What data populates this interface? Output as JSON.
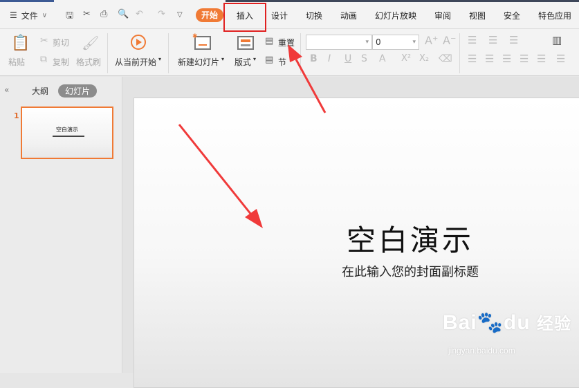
{
  "menu": {
    "file_label": "文件"
  },
  "tabs": [
    {
      "label": "开始"
    },
    {
      "label": "插入"
    },
    {
      "label": "设计"
    },
    {
      "label": "切换"
    },
    {
      "label": "动画"
    },
    {
      "label": "幻灯片放映"
    },
    {
      "label": "审阅"
    },
    {
      "label": "视图"
    },
    {
      "label": "安全"
    },
    {
      "label": "特色应用"
    }
  ],
  "ribbon": {
    "paste": "粘贴",
    "cut": "剪切",
    "copy": "复制",
    "format_painter": "格式刷",
    "from_current": "从当前开始",
    "new_slide": "新建幻灯片",
    "layout": "版式",
    "reset": "重置",
    "section": "节",
    "font_size": "0"
  },
  "left_panel": {
    "outline_tab": "大纲",
    "slides_tab": "幻灯片",
    "thumb_number": "1",
    "thumb_title": "空白演示"
  },
  "slide": {
    "title": "空白演示",
    "subtitle": "在此输入您的封面副标题"
  },
  "watermark": {
    "logo_left": "Bai",
    "logo_mid": "du",
    "logo_right": "经验",
    "url": "jingyan.baidu.com"
  },
  "colors": {
    "accent": "#f07a35",
    "highlight": "#e02020",
    "arrow": "#f03a3a"
  },
  "icons": [
    "menu-icon",
    "chevron-down-icon",
    "save-icon",
    "print-icon",
    "undo-icon",
    "redo-icon",
    "play-icon",
    "cut-icon",
    "copy-icon",
    "bold-icon",
    "italic-icon",
    "underline-icon"
  ]
}
